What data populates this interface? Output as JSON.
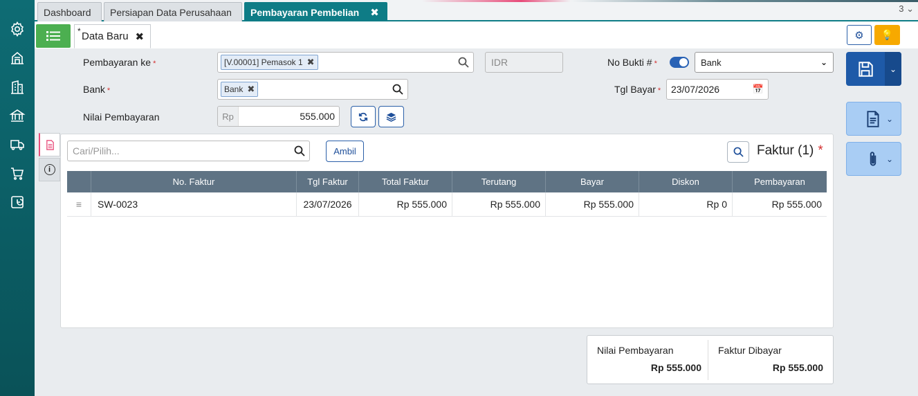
{
  "colors": {
    "sidebar": "#0e6c74",
    "active_tab": "#0e7c86",
    "primary": "#1e5aa8",
    "accent": "#f7a900",
    "success": "#4caf50",
    "required": "#d32f2f"
  },
  "sidebar": {
    "icons": [
      "gear-icon",
      "warehouse-icon",
      "building-icon",
      "bank-icon",
      "truck-icon",
      "cart-icon",
      "chart-icon"
    ]
  },
  "tabs": [
    {
      "label": "Dashboard"
    },
    {
      "label": "Persiapan Data Perusahaan"
    },
    {
      "label": "Pembayaran Pembelian",
      "active": true
    }
  ],
  "tab_count": "3",
  "subtab": {
    "marker": "*",
    "label": "Data Baru"
  },
  "form": {
    "pembayaran_ke_label": "Pembayaran ke",
    "pembayaran_ke_value": "[V.00001] Pemasok 1",
    "currency": "IDR",
    "bank_label": "Bank",
    "bank_value": "Bank",
    "nilai_label": "Nilai Pembayaran",
    "nilai_prefix": "Rp",
    "nilai_value": "555.000",
    "no_bukti_label": "No Bukti #",
    "no_bukti_select": "Bank",
    "tgl_bayar_label": "Tgl Bayar",
    "tgl_bayar_value": "23/07/2026"
  },
  "faktur": {
    "search_placeholder": "Cari/Pilih...",
    "ambil_label": "Ambil",
    "title": "Faktur (1)",
    "columns": [
      "No. Faktur",
      "Tgl Faktur",
      "Total Faktur",
      "Terutang",
      "Bayar",
      "Diskon",
      "Pembayaran"
    ],
    "rows": [
      {
        "no": "SW-0023",
        "tgl": "23/07/2026",
        "total": "Rp 555.000",
        "terutang": "Rp 555.000",
        "bayar": "Rp 555.000",
        "diskon": "Rp 0",
        "pembayaran": "Rp 555.000"
      }
    ]
  },
  "summary": {
    "nilai_label": "Nilai Pembayaran",
    "nilai_value": "Rp 555.000",
    "faktur_label": "Faktur Dibayar",
    "faktur_value": "Rp 555.000"
  }
}
